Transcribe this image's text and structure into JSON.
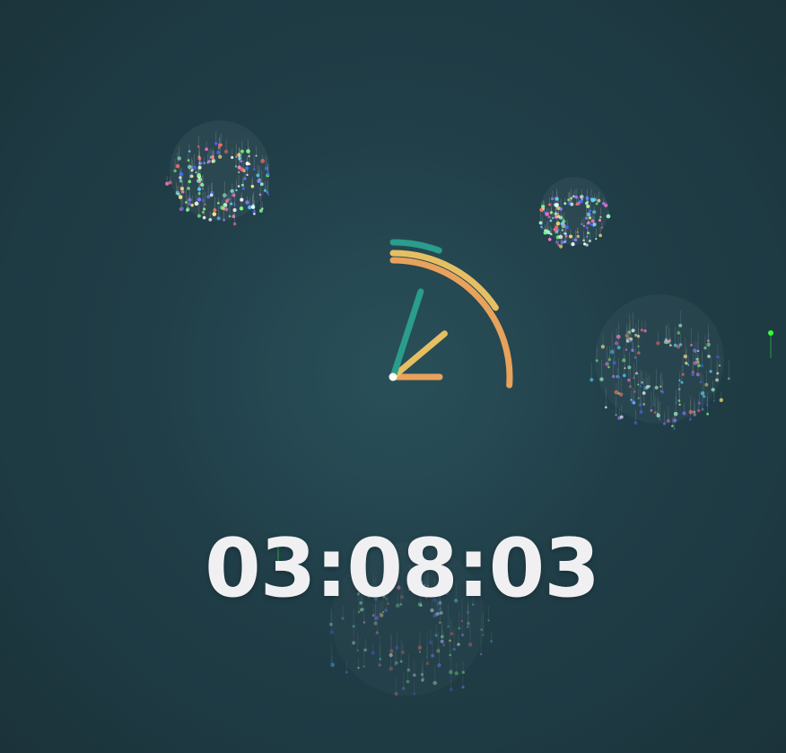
{
  "clock": {
    "time_text": "03:08:03",
    "hours": 3,
    "minutes": 8,
    "seconds": 3,
    "colors": {
      "hour": "#e8a25c",
      "minute": "#e6bf62",
      "second": "#2a9d8c",
      "center_dot": "#ffffff"
    }
  },
  "background": {
    "color_center": "#25474f",
    "color_edge": "#1b3239"
  },
  "fireworks": {
    "palette": [
      "#ffffff",
      "#9ff0c8",
      "#ff7ad9",
      "#8a7dff",
      "#5fd3ff",
      "#ffe17a",
      "#7cff7c",
      "#ff6b6b",
      "#3b6cff"
    ],
    "bursts": [
      {
        "name": "burst-top-left",
        "style": "tight"
      },
      {
        "name": "burst-top-right",
        "style": "tight"
      },
      {
        "name": "burst-right",
        "style": "fading"
      },
      {
        "name": "burst-bottom",
        "style": "fading"
      },
      {
        "name": "spark-right",
        "style": "spark",
        "color": "#33ff33"
      },
      {
        "name": "spark-bottom",
        "style": "spark",
        "color": "#33ff33"
      }
    ]
  }
}
